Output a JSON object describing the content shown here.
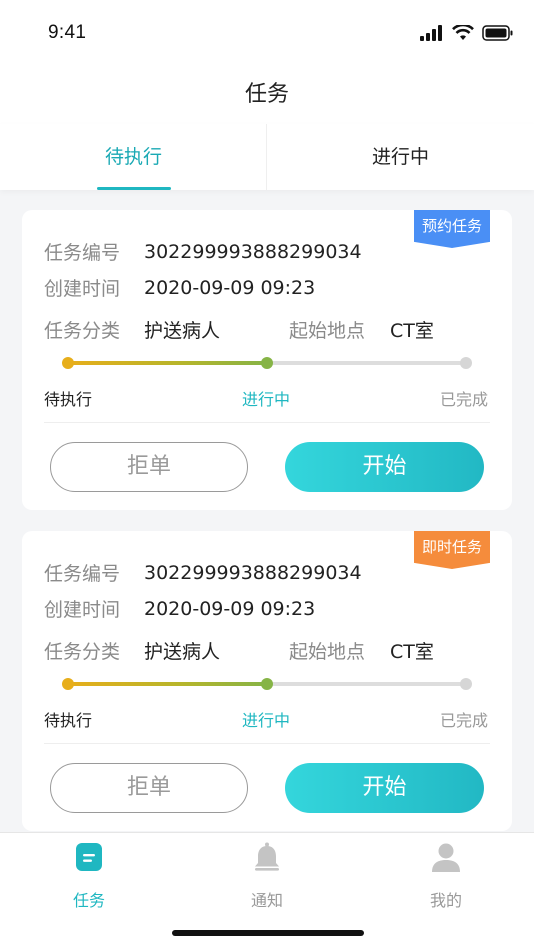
{
  "status": {
    "time": "9:41"
  },
  "header": {
    "title": "任务"
  },
  "tabs": [
    {
      "label": "待执行",
      "active": true
    },
    {
      "label": "进行中",
      "active": false
    }
  ],
  "cards": [
    {
      "badge": "预约任务",
      "badge_color": "#4a8ff5",
      "task_no_label": "任务编号",
      "task_no": "302299993888299034",
      "created_label": "创建时间",
      "created": "2020-09-09 09:23",
      "category_label": "任务分类",
      "category": "护送病人",
      "origin_label": "起始地点",
      "origin": "CT室",
      "progress_fraction": 0.5,
      "steps": [
        "待执行",
        "进行中",
        "已完成"
      ],
      "reject_label": "拒单",
      "start_label": "开始"
    },
    {
      "badge": "即时任务",
      "badge_color": "#f58c3c",
      "task_no_label": "任务编号",
      "task_no": "302299993888299034",
      "created_label": "创建时间",
      "created": "2020-09-09 09:23",
      "category_label": "任务分类",
      "category": "护送病人",
      "origin_label": "起始地点",
      "origin": "CT室",
      "progress_fraction": 0.5,
      "steps": [
        "待执行",
        "进行中",
        "已完成"
      ],
      "reject_label": "拒单",
      "start_label": "开始"
    }
  ],
  "bottom_nav": [
    {
      "label": "任务",
      "icon": "task-icon",
      "active": true
    },
    {
      "label": "通知",
      "icon": "bell-icon",
      "active": false
    },
    {
      "label": "我的",
      "icon": "person-icon",
      "active": false
    }
  ],
  "colors": {
    "accent": "#1fb7c1",
    "step_done": "#e7ae1b",
    "step_current": "#86b446",
    "step_pending": "#dddddd"
  }
}
